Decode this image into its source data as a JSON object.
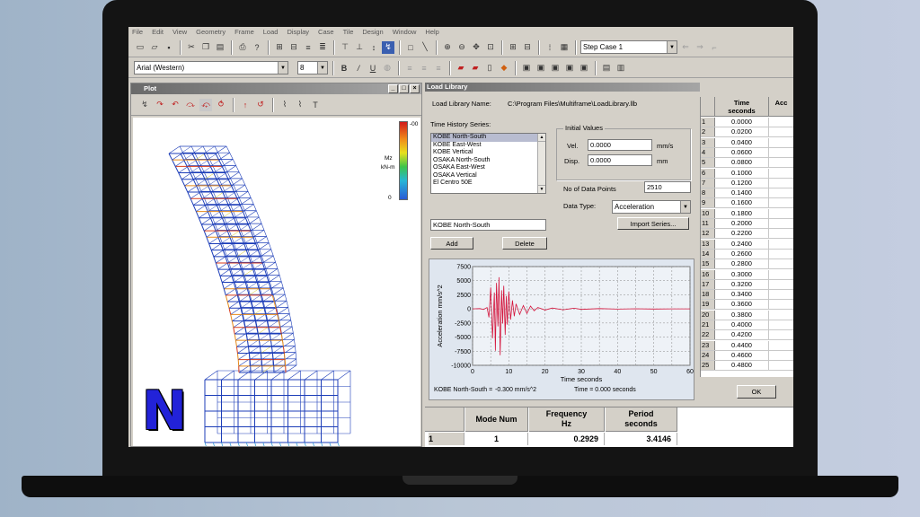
{
  "menu": [
    "File",
    "Edit",
    "View",
    "Geometry",
    "Frame",
    "Load",
    "Display",
    "Case",
    "Tile",
    "Design",
    "Window",
    "Help"
  ],
  "toolbar": {
    "step_case": "Step Case 1",
    "font_name": "Arial (Western)",
    "font_size": "8"
  },
  "plot_window": {
    "title": "Plot",
    "colorbar_max": "-00",
    "colorbar_min": "0",
    "colorbar_unit1": "Mz",
    "colorbar_unit2": "kN-m"
  },
  "load_library": {
    "title": "Load Library",
    "name_label": "Load Library Name:",
    "name_value": "C:\\Program Files\\Multiframe\\LoadLibrary.llb",
    "series_label": "Time History Series:",
    "series": [
      "KOBE North-South",
      "KOBE East-West",
      "KOBE Vertical",
      "OSAKA North-South",
      "OSAKA East-West",
      "OSAKA Vertical",
      "El Centro 50E"
    ],
    "initial_values_label": "Initial Values",
    "vel_label": "Vel.",
    "vel_value": "0.0000",
    "vel_unit": "mm/s",
    "disp_label": "Disp.",
    "disp_value": "0.0000",
    "disp_unit": "mm",
    "points_label": "No of Data Points",
    "points_value": "2510",
    "datatype_label": "Data Type:",
    "datatype_value": "Acceleration",
    "import_label": "Import Series...",
    "name_field": "KOBE North-South",
    "add_label": "Add",
    "delete_label": "Delete",
    "readout_series": "KOBE North-South =",
    "readout_value": "-0.300 mm/s^2",
    "readout_time": "Time =  0.000 seconds",
    "ok_label": "OK"
  },
  "chart_data": {
    "type": "line",
    "xlabel": "Time  seconds",
    "ylabel": "Acceleration  mm/s^2",
    "xlim": [
      0,
      60
    ],
    "ylim": [
      -10000,
      7500
    ],
    "xticks": [
      0,
      5,
      10,
      15,
      20,
      25,
      30,
      35,
      40,
      45,
      50,
      55,
      60
    ],
    "yticks": [
      7500,
      5000,
      2500,
      0,
      -2500,
      -5000,
      -7500,
      -10000
    ],
    "ytick_labels": [
      "7500",
      "5000",
      "2500",
      "0",
      "-2500",
      "-5000",
      "-7500",
      "-10000"
    ],
    "grid": true,
    "series": [
      {
        "x": [
          0,
          2,
          3,
          4,
          4.5,
          5,
          5.5,
          6,
          6.3,
          6.6,
          7,
          7.3,
          7.6,
          8,
          8.3,
          8.6,
          9,
          9.3,
          9.6,
          10,
          10.5,
          11,
          11.5,
          12,
          13,
          14,
          15,
          16,
          17,
          18,
          20,
          22,
          25,
          28,
          30,
          35,
          40,
          45,
          50,
          55,
          60
        ],
        "y": [
          0,
          60,
          -100,
          250,
          -1500,
          3800,
          -5200,
          2900,
          -7400,
          4600,
          -3100,
          5600,
          -8200,
          3300,
          -2600,
          4100,
          -4600,
          2300,
          -2800,
          3100,
          -1900,
          1500,
          -1300,
          900,
          -1000,
          600,
          -800,
          500,
          -350,
          250,
          -200,
          150,
          -150,
          120,
          -90,
          60,
          -40,
          25,
          -20,
          10,
          0
        ],
        "color": "#d4143c"
      }
    ]
  },
  "time_table": {
    "header1": "Time\nseconds",
    "header2": "Acc",
    "rows": [
      [
        "1",
        "0.0000"
      ],
      [
        "2",
        "0.0200"
      ],
      [
        "3",
        "0.0400"
      ],
      [
        "4",
        "0.0600"
      ],
      [
        "5",
        "0.0800"
      ],
      [
        "6",
        "0.1000"
      ],
      [
        "7",
        "0.1200"
      ],
      [
        "8",
        "0.1400"
      ],
      [
        "9",
        "0.1600"
      ],
      [
        "10",
        "0.1800"
      ],
      [
        "11",
        "0.2000"
      ],
      [
        "12",
        "0.2200"
      ],
      [
        "13",
        "0.2400"
      ],
      [
        "14",
        "0.2600"
      ],
      [
        "15",
        "0.2800"
      ],
      [
        "16",
        "0.3000"
      ],
      [
        "17",
        "0.3200"
      ],
      [
        "18",
        "0.3400"
      ],
      [
        "19",
        "0.3600"
      ],
      [
        "20",
        "0.3800"
      ],
      [
        "21",
        "0.4000"
      ],
      [
        "22",
        "0.4200"
      ],
      [
        "23",
        "0.4400"
      ],
      [
        "24",
        "0.4600"
      ],
      [
        "25",
        "0.4800"
      ]
    ]
  },
  "mode_table": {
    "header_mode": "Mode Num",
    "header_freq": "Frequency\nHz",
    "header_period": "Period\nseconds",
    "row_index": "1",
    "mode": "1",
    "freq": "0.2929",
    "period": "3.4146"
  },
  "brand": {
    "letter": "N",
    "color": "#2222d8"
  }
}
